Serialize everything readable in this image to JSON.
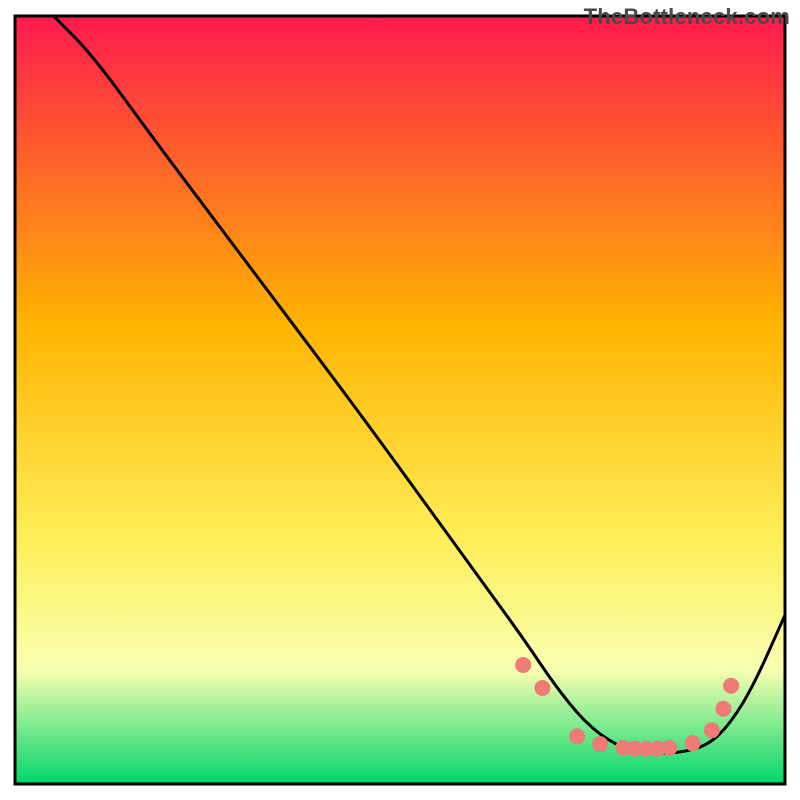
{
  "watermark": "TheBottleneck.com",
  "chart_data": {
    "type": "line",
    "title": "",
    "xlabel": "",
    "ylabel": "",
    "xlim": [
      0,
      100
    ],
    "ylim": [
      0,
      100
    ],
    "gradient_top_color": "#ff1a4f",
    "gradient_mid1_color": "#ffb300",
    "gradient_mid2_color": "#ffee58",
    "gradient_mid3_color": "#f8ffb0",
    "gradient_bottom_color": "#00d66b",
    "border_color": "#000000",
    "series": [
      {
        "name": "bottleneck-curve",
        "color": "#000000",
        "x": [
          5,
          10,
          18,
          30,
          45,
          58,
          66,
          70,
          74,
          78,
          82,
          86,
          90,
          93,
          96,
          100
        ],
        "y": [
          100,
          95,
          84,
          68,
          48,
          30,
          19,
          13,
          8,
          5,
          4,
          4,
          5,
          8,
          13,
          22
        ]
      }
    ],
    "markers": {
      "name": "optimal-points",
      "color": "#ef7b76",
      "radius": 8,
      "x": [
        66,
        68.5,
        73,
        76,
        79,
        80.5,
        82,
        83.5,
        85,
        88,
        90.5,
        92,
        93
      ],
      "y": [
        15.5,
        12.5,
        6.2,
        5.2,
        4.7,
        4.6,
        4.6,
        4.6,
        4.7,
        5.3,
        7.0,
        9.8,
        12.8
      ]
    }
  }
}
